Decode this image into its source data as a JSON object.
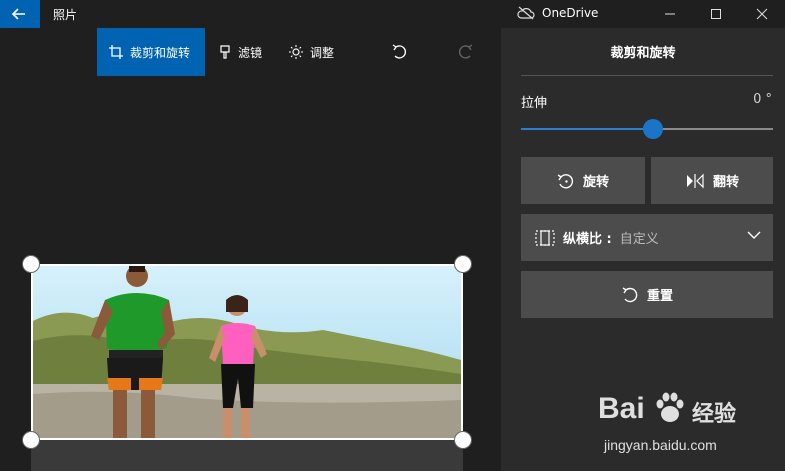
{
  "window": {
    "app_title": "照片",
    "onedrive_label": "OneDrive"
  },
  "toolbar": {
    "crop_rotate": "裁剪和旋转",
    "filter": "滤镜",
    "adjust": "调整"
  },
  "panel": {
    "title": "裁剪和旋转",
    "stretch_label": "拉伸",
    "stretch_value": "0 °",
    "stretch_level": 0.5,
    "rotate": "旋转",
    "flip": "翻转",
    "aspect_label": "纵横比 :",
    "aspect_value": "自定义",
    "reset": "重置"
  },
  "watermark": {
    "brand": "Bai",
    "suffix": "经验",
    "url": "jingyan.baidu.com"
  },
  "colors": {
    "accent": "#0063b1",
    "slider": "#1a75c7",
    "panel_bg": "#2b2b2b",
    "button_bg": "#4c4c4c"
  },
  "icons": [
    "back-arrow-icon",
    "cloud-off-icon",
    "minimize-icon",
    "maximize-icon",
    "close-icon",
    "crop-icon",
    "filter-icon",
    "brightness-icon",
    "undo-icon",
    "redo-icon",
    "rotate-icon",
    "flip-icon",
    "aspect-ratio-icon",
    "chevron-down-icon",
    "reset-icon"
  ]
}
